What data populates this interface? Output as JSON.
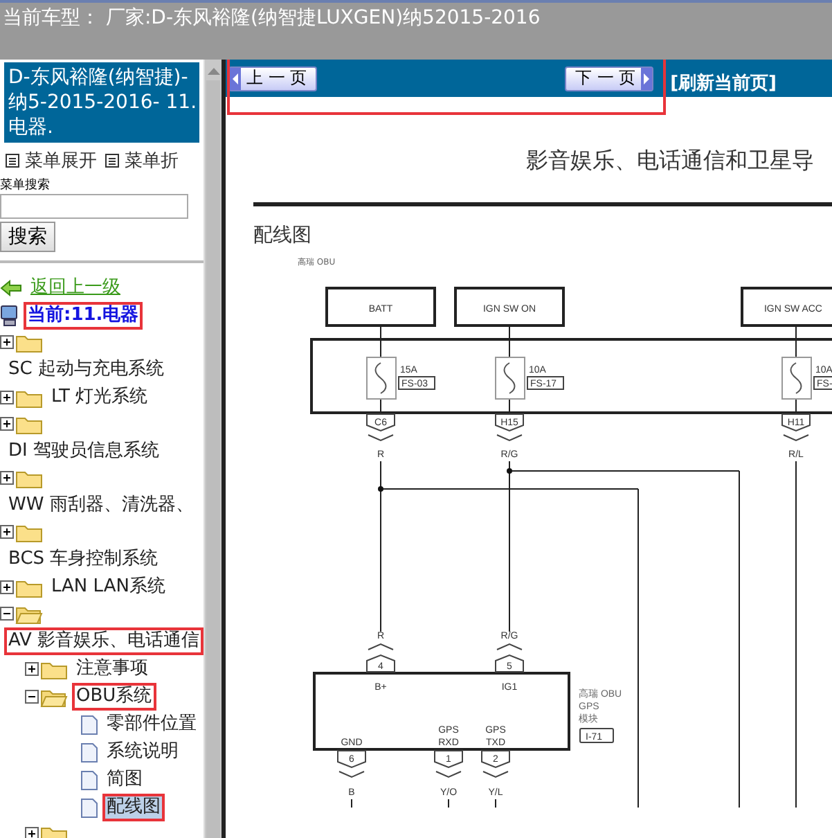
{
  "header": {
    "title": "当前车型：  厂家:D-东风裕隆(纳智捷LUXGEN)纳52015-2016"
  },
  "sidebar": {
    "banner": "D-东风裕隆(纳智捷)-纳5-2015-2016- 11.电器.",
    "menu_actions": [
      {
        "label": "菜单展开"
      },
      {
        "label": "菜单折"
      }
    ],
    "search": {
      "label": "菜单搜索",
      "button": "搜索"
    },
    "tree": [
      {
        "kind": "back",
        "label": "返回上一级",
        "selected": false,
        "highlighted": false
      },
      {
        "kind": "current",
        "label": "当前:11.电器",
        "selected": false,
        "highlighted": true
      },
      {
        "kind": "folder",
        "label": "SC 起动与充电系统",
        "expanded": false,
        "selected": false,
        "highlighted": false
      },
      {
        "kind": "folder",
        "label": "LT 灯光系统",
        "expanded": false,
        "selected": false,
        "highlighted": false
      },
      {
        "kind": "folder",
        "label": "DI 驾驶员信息系统",
        "expanded": false,
        "selected": false,
        "highlighted": false
      },
      {
        "kind": "folder",
        "label": "WW 雨刮器、清洗器、",
        "expanded": false,
        "selected": false,
        "highlighted": false
      },
      {
        "kind": "folder",
        "label": "BCS 车身控制系统",
        "expanded": false,
        "selected": false,
        "highlighted": false
      },
      {
        "kind": "folder",
        "label": "LAN LAN系统",
        "expanded": false,
        "selected": false,
        "highlighted": false
      },
      {
        "kind": "folder",
        "label": "AV 影音娱乐、电话通信",
        "expanded": true,
        "selected": false,
        "highlighted": true,
        "children": [
          {
            "kind": "folder",
            "label": "注意事项",
            "expanded": false,
            "selected": false,
            "highlighted": false
          },
          {
            "kind": "folder",
            "label": "OBU系统",
            "expanded": true,
            "selected": false,
            "highlighted": true,
            "children": [
              {
                "kind": "page",
                "label": "零部件位置",
                "selected": false,
                "highlighted": false
              },
              {
                "kind": "page",
                "label": "系统说明",
                "selected": false,
                "highlighted": false
              },
              {
                "kind": "page",
                "label": "简图",
                "selected": false,
                "highlighted": false
              },
              {
                "kind": "page",
                "label": "配线图",
                "selected": true,
                "highlighted": true
              }
            ]
          },
          {
            "kind": "folder",
            "expanded": false
          }
        ]
      }
    ]
  },
  "document": {
    "nav": {
      "prev": "上 一 页",
      "next": "下 一 页",
      "refresh": "[刷新当前页]",
      "highlighted": true
    },
    "title": "影音娱乐、电话通信和卫星导",
    "section": "配线图",
    "caption": "高瑞 OBU",
    "diagram": {
      "sources": [
        {
          "label": "BATT",
          "fuse_rating": "15A",
          "fuse_id": "FS-03",
          "pin": "C6",
          "wire": "R"
        },
        {
          "label": "IGN SW ON",
          "fuse_rating": "10A",
          "fuse_id": "FS-17",
          "pin": "H15",
          "wire": "R/G"
        },
        {
          "label": "IGN SW ACC",
          "fuse_rating": "10A",
          "fuse_id": "FS-",
          "pin": "H11",
          "wire": "R/L"
        }
      ],
      "module": {
        "name_lines": [
          "高瑞 OBU",
          "GPS",
          "模块"
        ],
        "connector": "I-71",
        "inputs": [
          {
            "wire": "R",
            "pin": "4",
            "signal": "B+"
          },
          {
            "wire": "R/G",
            "pin": "5",
            "signal": "IG1"
          }
        ],
        "outputs": [
          {
            "signal_lines": [
              "GND"
            ],
            "pin": "6",
            "wire": "B"
          },
          {
            "signal_lines": [
              "GPS",
              "RXD"
            ],
            "pin": "1",
            "wire": "Y/O"
          },
          {
            "signal_lines": [
              "GPS",
              "TXD"
            ],
            "pin": "2",
            "wire": "Y/L"
          }
        ]
      }
    }
  }
}
